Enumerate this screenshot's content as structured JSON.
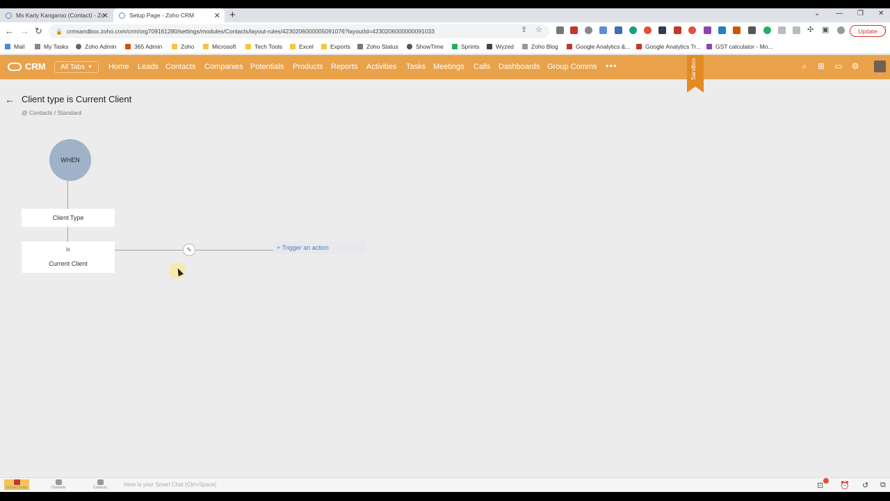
{
  "browser": {
    "tabs": [
      {
        "title": "Ms Karly Kangaroo (Contact) - Zo",
        "active": false
      },
      {
        "title": "Setup Page - Zoho CRM",
        "active": true
      }
    ],
    "url": "crmsandbox.zoho.com/crm/org709161280/settings/modules/Contacts/layout-rules/4230206000005091076?layoutId=4230206000000091033",
    "update_label": "Update",
    "bookmarks": [
      "Mail",
      "My Tasks",
      "Zoho Admin",
      "365 Admin",
      "Zoho",
      "Microsoft",
      "Tech Tools",
      "Excel",
      "Exports",
      "Zoho Status",
      "ShowTime",
      "Sprints",
      "Wyzed",
      "Zoho Blog",
      "Google Analytics &...",
      "Google Analytics Tr...",
      "GST calculator - Mo..."
    ]
  },
  "crm": {
    "logo": "CRM",
    "all_tabs": "All Tabs",
    "nav": [
      "Home",
      "Leads",
      "Contacts",
      "Companies",
      "Potentials",
      "Products",
      "Reports",
      "Activities",
      "Tasks",
      "Meetings",
      "Calls",
      "Dashboards",
      "Group Comms"
    ],
    "more": "•••",
    "sandbox": "Sandbox"
  },
  "rule": {
    "title": "Client type is Current Client",
    "breadcrumb": "@ Contacts / Standard",
    "when": "WHEN",
    "field": "Client Type",
    "operator": "is",
    "value": "Current Client",
    "trigger": "+ Trigger an action"
  },
  "footer": {
    "items": [
      "Unread Chats",
      "Channels",
      "Contacts"
    ],
    "smart_chat": "Here is your Smart Chat (Ctrl+Space)"
  },
  "colors": {
    "nav_bg": "#e9a24a",
    "when_node": "#9fb2c7",
    "link": "#4a7fb5"
  }
}
